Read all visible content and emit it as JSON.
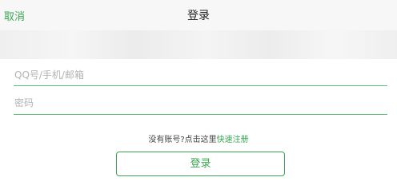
{
  "header": {
    "cancel_label": "取消",
    "title": "登录"
  },
  "form": {
    "account_placeholder": "QQ号/手机/邮箱",
    "password_placeholder": "密码"
  },
  "register": {
    "prompt": "没有账号?点击这里",
    "link": "快速注册"
  },
  "login_button": "登录",
  "colors": {
    "accent": "#3aa651",
    "divider": "#5bbf7a",
    "topbar_bg": "#f7f7f7"
  }
}
